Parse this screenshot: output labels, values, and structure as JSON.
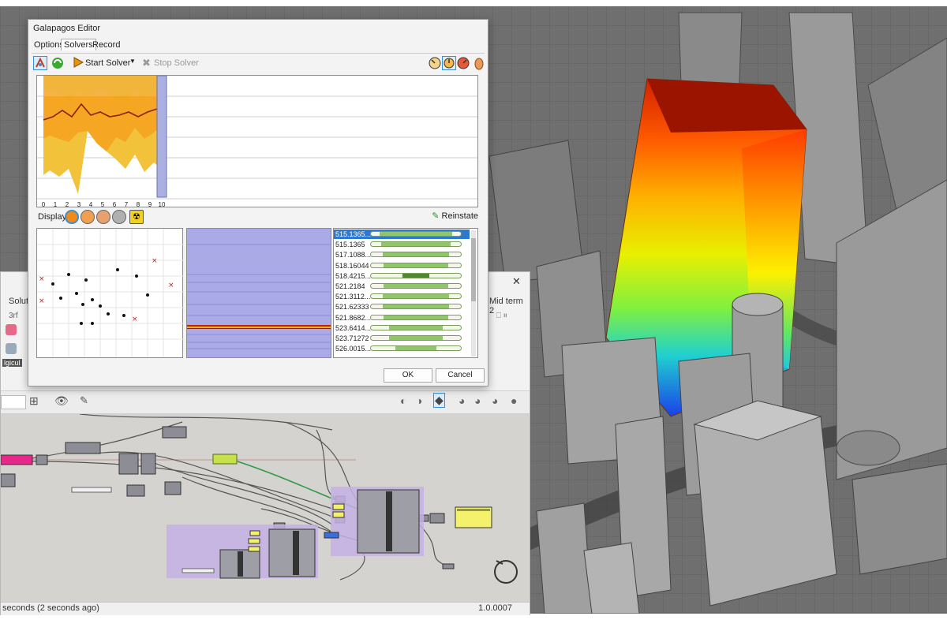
{
  "galapagos": {
    "title": "Galapagos Editor",
    "tabs": [
      "Options",
      "Solvers",
      "Record"
    ],
    "active_tab": "Solvers",
    "toolbar": {
      "start_solver": "Start Solver",
      "stop_solver": "Stop Solver"
    },
    "graph": {
      "x_ticks": [
        "0",
        "1",
        "2",
        "3",
        "4",
        "5",
        "6",
        "7",
        "8",
        "9",
        "10"
      ]
    },
    "display_label": "Display",
    "reinstate_label": "Reinstate",
    "solutions": [
      {
        "value": "515.1365...",
        "fill": 0.8,
        "selected": true
      },
      {
        "value": "515.1365",
        "fill": 0.78
      },
      {
        "value": "517.1088...",
        "fill": 0.74
      },
      {
        "value": "518.16044",
        "fill": 0.72
      },
      {
        "value": "518.4215...",
        "fill": 0.3
      },
      {
        "value": "521.2184",
        "fill": 0.72
      },
      {
        "value": "521.3112...",
        "fill": 0.74
      },
      {
        "value": "521.62333",
        "fill": 0.74
      },
      {
        "value": "521.8682...",
        "fill": 0.72
      },
      {
        "value": "523.6414...",
        "fill": 0.6
      },
      {
        "value": "523.71272",
        "fill": 0.6
      },
      {
        "value": "526.0015...",
        "fill": 0.45
      }
    ],
    "ok_label": "OK",
    "cancel_label": "Cancel"
  },
  "grasshopper": {
    "tab_left": "Soluti",
    "tab_right": "Mid term 2",
    "row2_text": "3rf",
    "side_label": "lgicul",
    "status_text": "seconds (2 seconds ago)",
    "version": "1.0.0007",
    "colors": {
      "canvas": "#d4d3cf",
      "group_purple": "#c4b0e4",
      "pink_param": "#e8278a",
      "yellow_panel": "#f4f26a",
      "green_slider": "#c8e04c"
    }
  },
  "viewport": {
    "colors": {
      "background": "#6b6b6b",
      "building": "#8e8e8e",
      "heatmap_top": "#b51a00",
      "heatmap_low": "#1a5cf0"
    }
  }
}
